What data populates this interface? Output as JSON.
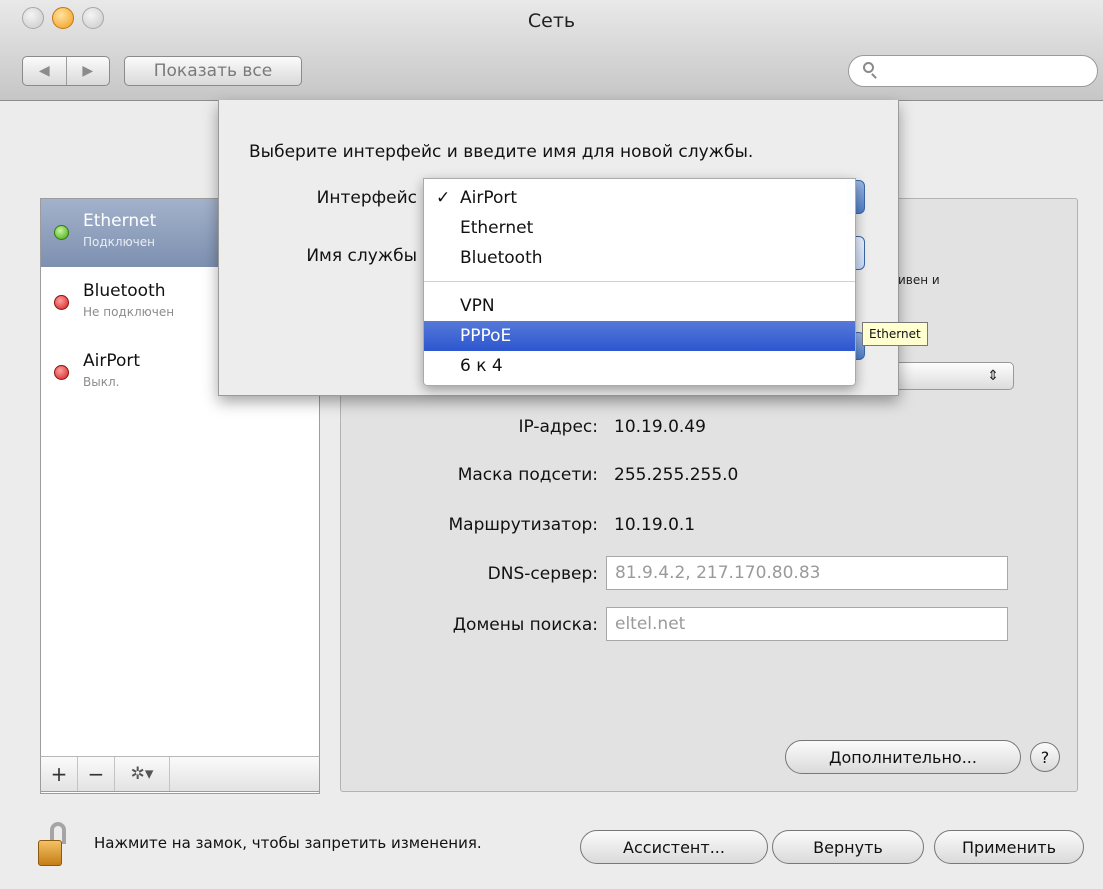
{
  "window": {
    "title": "Сеть"
  },
  "toolbar": {
    "back_icon": "◀",
    "forward_icon": "▶",
    "show_all": "Показать все",
    "search_placeholder": ""
  },
  "sidebar": {
    "items": [
      {
        "name": "Ethernet",
        "status": "Подключен",
        "state": "green",
        "selected": true
      },
      {
        "name": "Bluetooth",
        "status": "Не подключен",
        "state": "red",
        "selected": false
      },
      {
        "name": "AirPort",
        "status": "Выкл.",
        "state": "red",
        "selected": false
      }
    ],
    "add_label": "+",
    "remove_label": "−",
    "gear_label": "✲▾"
  },
  "sheet": {
    "title": "Выберите интерфейс и введите имя для новой службы.",
    "interface_label": "Интерфейс",
    "service_name_label": "Имя службы"
  },
  "menu": {
    "items": [
      {
        "label": "AirPort",
        "checked": true
      },
      {
        "label": "Ethernet",
        "checked": false
      },
      {
        "label": "Bluetooth",
        "checked": false
      },
      {
        "label": "VPN",
        "checked": false
      },
      {
        "label": "PPPoE",
        "checked": false,
        "highlighted": true
      },
      {
        "label": "6 к 4",
        "checked": false
      }
    ]
  },
  "detail": {
    "partial_text": "ивен и",
    "tooltip": "Ethernet",
    "select_arrows": "⇕",
    "ip_label": "IP-адрес:",
    "ip_value": "10.19.0.49",
    "mask_label": "Маска подсети:",
    "mask_value": "255.255.255.0",
    "router_label": "Маршрутизатор:",
    "router_value": "10.19.0.1",
    "dns_label": "DNS-сервер:",
    "dns_value": "81.9.4.2, 217.170.80.83",
    "search_domains_label": "Домены поиска:",
    "search_domains_value": "eltel.net",
    "advanced_button": "Дополнительно...",
    "help_button": "?"
  },
  "footer": {
    "lock_text": "Нажмите на замок, чтобы запретить изменения.",
    "assistant_button": "Ассистент...",
    "revert_button": "Вернуть",
    "apply_button": "Применить"
  }
}
